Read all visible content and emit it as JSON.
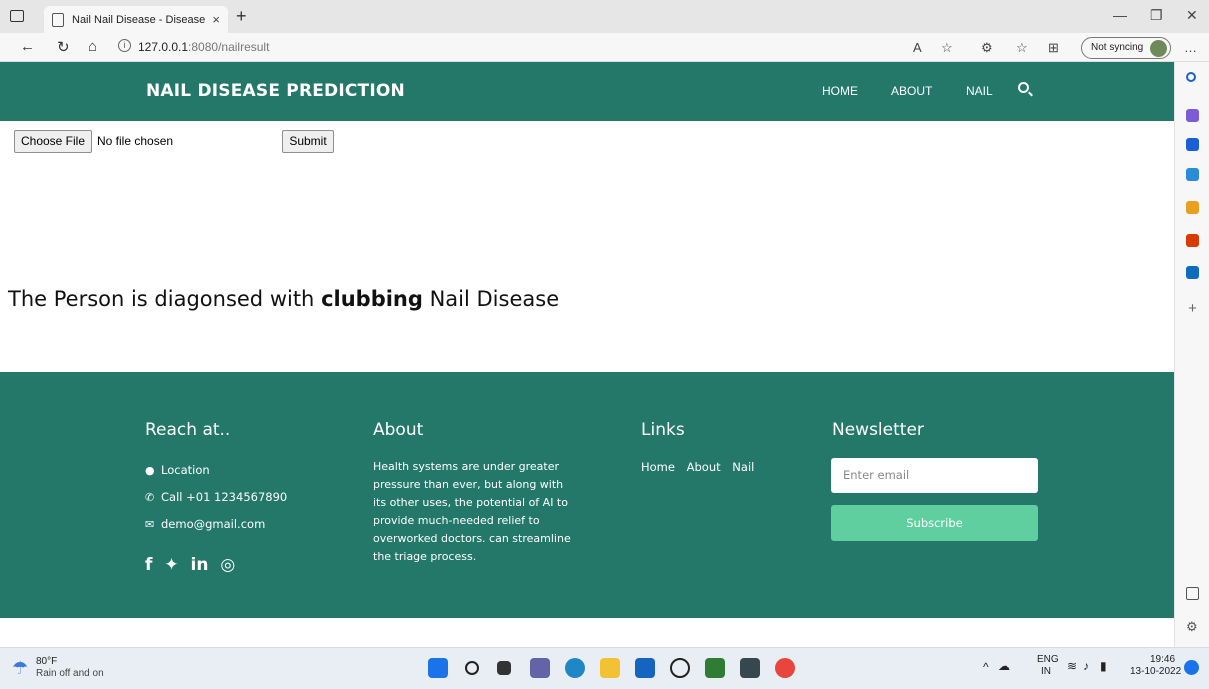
{
  "browser": {
    "tab_title": "Nail Nail Disease - Disease Predi",
    "tab_close": "×",
    "new_tab": "+",
    "url_host": "127.0.0.1",
    "url_rest": ":8080/nailresult",
    "sync_label": "Not syncing",
    "win_minimize": "—",
    "win_restore": "❐",
    "win_close": "✕"
  },
  "navbar": {
    "brand": "NAIL DISEASE PREDICTION",
    "links": [
      "HOME",
      "ABOUT",
      "NAIL"
    ]
  },
  "upload": {
    "choose_label": "Choose File",
    "file_status": "No file chosen",
    "submit_label": "Submit"
  },
  "result": {
    "prefix": "The Person is diagonsed with",
    "disease": "clubbing",
    "suffix": "Nail Disease"
  },
  "footer": {
    "reach": {
      "heading": "Reach at..",
      "location": "Location",
      "phone": "Call +01 1234567890",
      "email": "demo@gmail.com"
    },
    "about": {
      "heading": "About",
      "text": "Health systems are under greater pressure than ever, but along with its other uses, the potential of AI to provide much-needed relief to overworked doctors. can streamline the triage process."
    },
    "links": {
      "heading": "Links",
      "items": [
        "Home",
        "About",
        "Nail"
      ]
    },
    "newsletter": {
      "heading": "Newsletter",
      "placeholder": "Enter email",
      "button": "Subscribe"
    },
    "social_icons": [
      "facebook-icon",
      "twitter-icon",
      "linkedin-icon",
      "instagram-icon"
    ]
  },
  "taskbar": {
    "temp": "80°F",
    "weather": "Rain off and on",
    "lang": "ENG",
    "region": "IN",
    "time": "19:46",
    "date": "13-10-2022"
  },
  "colors": {
    "brand_green": "#23786a",
    "subscribe_green": "#5fcf9f"
  }
}
